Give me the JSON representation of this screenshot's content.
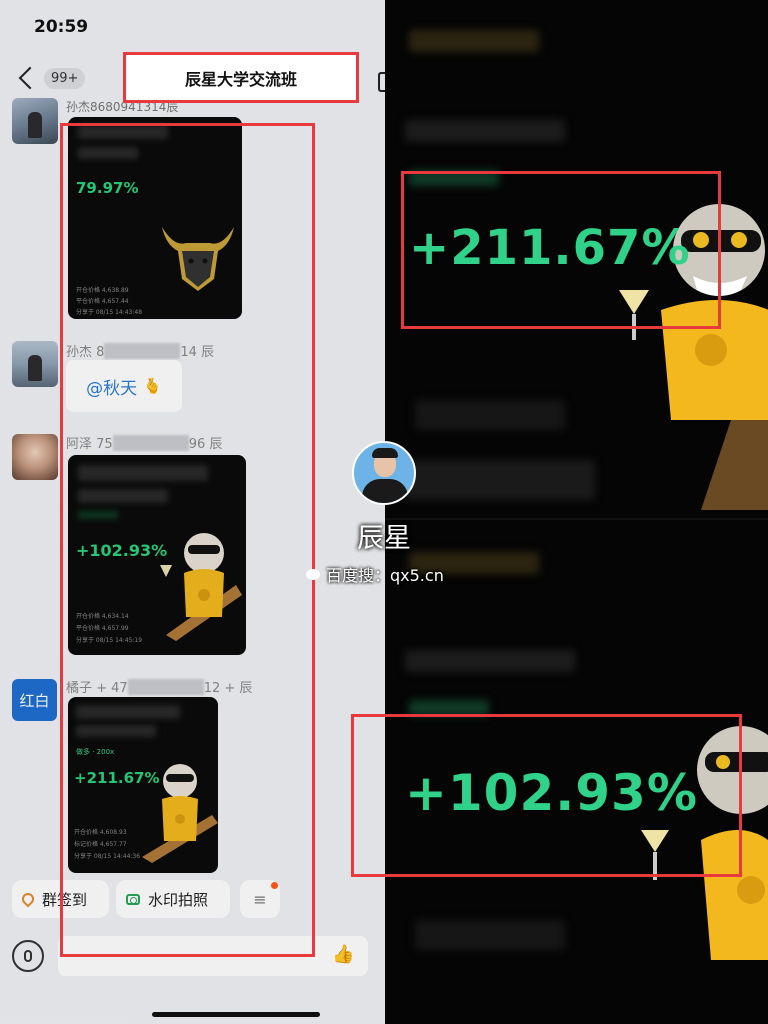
{
  "status": {
    "time": "20:59"
  },
  "nav": {
    "back_count": "99+",
    "title": "辰星大学交流班"
  },
  "chat": {
    "top_clipped": "孙杰8680941314辰",
    "card1": {
      "pct": "79.97%",
      "rows": [
        "开仓价格  4,638.89",
        "平仓价格  4,657.44",
        "分享于 08/15 14:43:48"
      ]
    },
    "msg2": {
      "sender_prefix": "孙杰 8",
      "sender_suffix": "14 辰",
      "mention": "@秋天",
      "emoji": "🫰"
    },
    "msg3": {
      "sender_prefix": "阿泽 75",
      "sender_suffix": "96 辰"
    },
    "card2": {
      "pct": "+102.93%",
      "rows": [
        "开仓价格  4,634.14",
        "平仓价格  4,657.99",
        "分享于 08/15 14:45:19"
      ]
    },
    "msg4": {
      "sender_prefix": "橘子 + 47",
      "sender_suffix": "12 + 辰"
    },
    "card3": {
      "lev": "做多 · 200x",
      "pct": "+211.67%",
      "rows": [
        "开仓价格  4,608.93",
        "标记价格  4,657.77",
        "分享于 08/15 14:44:36"
      ]
    },
    "hongbai": "红白"
  },
  "toolbar": {
    "sign_in": "群签到",
    "watermark_photo": "水印拍照",
    "more": "≡"
  },
  "input": {
    "like": "👍"
  },
  "right": {
    "pct_top": "+211.67%",
    "pct_bottom": "+102.93%"
  },
  "overlay": {
    "name": "辰星",
    "search_line": "百度搜：qx5.cn"
  },
  "colors": {
    "accent_red": "#e8393e",
    "profit_green": "#2fd288"
  }
}
